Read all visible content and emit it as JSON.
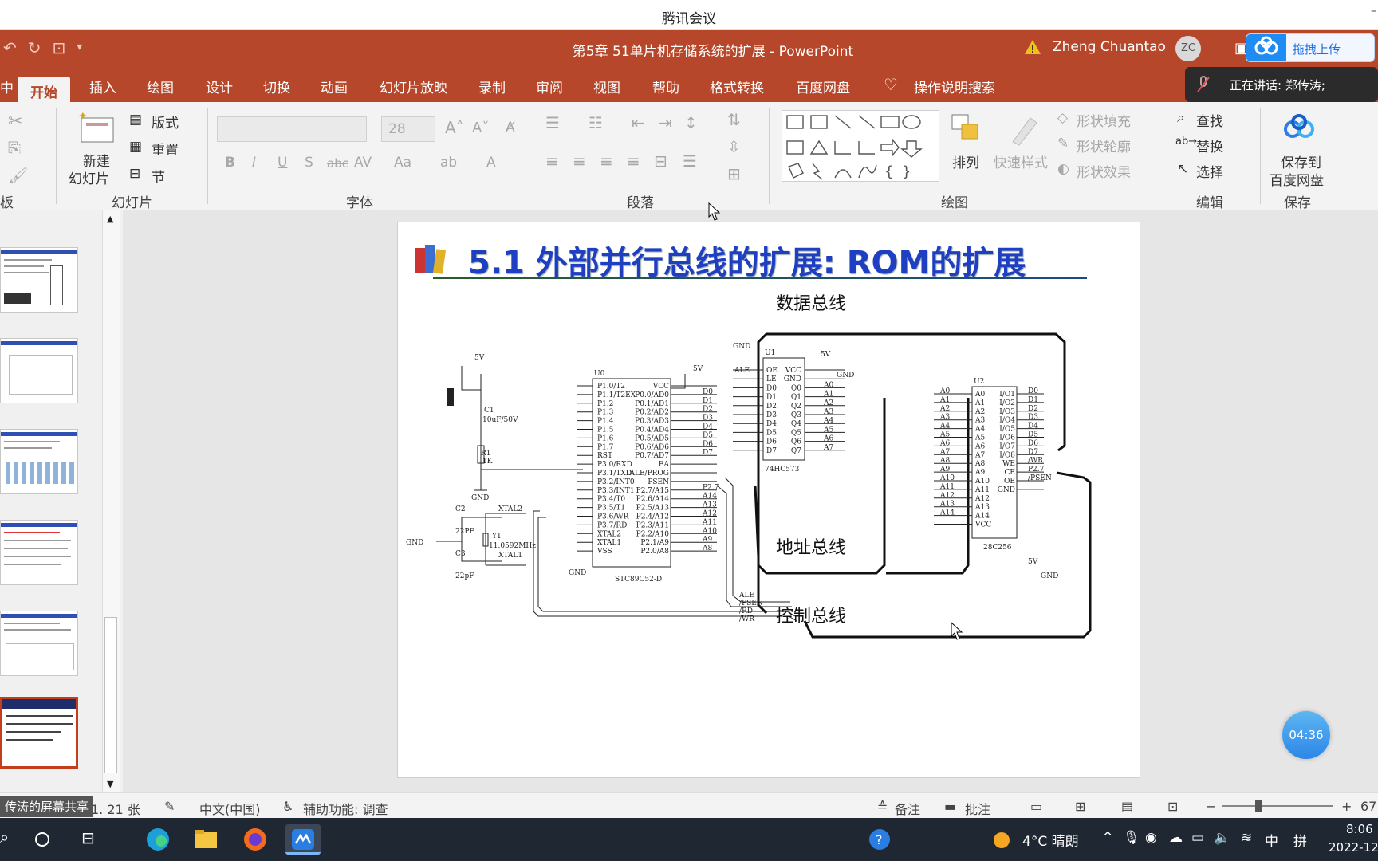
{
  "meeting": {
    "window_title": "腾讯会议",
    "dash": "–"
  },
  "app": {
    "doc_title": "第5章 51单片机存储系统的扩展 - PowerPoint",
    "user_name": "Zheng Chuantao",
    "user_initials": "ZC",
    "upload_label": "拖拽上传",
    "speaking_label": "正在讲话: 郑传涛;"
  },
  "tabs": [
    "中",
    "开始",
    "插入",
    "绘图",
    "设计",
    "切换",
    "动画",
    "幻灯片放映",
    "录制",
    "审阅",
    "视图",
    "帮助",
    "格式转换",
    "百度网盘",
    "操作说明搜索"
  ],
  "ribbon": {
    "clipboard_label": "板",
    "new_slide_line1": "新建",
    "new_slide_line2": "幻灯片",
    "layout": "版式",
    "reset": "重置",
    "section": "节",
    "slides_label": "幻灯片",
    "font_size": "28",
    "font_label": "字体",
    "paragraph_label": "段落",
    "arrange": "排列",
    "quick_styles": "快速样式",
    "shape_fill": "形状填充",
    "shape_outline": "形状轮廓",
    "shape_effects": "形状效果",
    "drawing_label": "绘图",
    "find": "查找",
    "replace": "替换",
    "select": "选择",
    "editing_label": "编辑",
    "save_line1": "保存到",
    "save_line2": "百度网盘",
    "save_label": "保存"
  },
  "slide": {
    "title": "5.1 外部并行总线的扩展: ROM的扩展",
    "bus_data": "数据总线",
    "bus_address": "地址总线",
    "bus_control": "控制总线",
    "chip_mcu": "STC89C52-D",
    "chip_latch": "74HC573",
    "chip_rom": "28C256",
    "crystal": "11.0592MHz",
    "label_u0": "U0",
    "label_u1": "U1",
    "label_u2": "U2",
    "c1": "C1",
    "c1_val": "10uF/50V",
    "r1": "R1",
    "r1_val": "1K",
    "c2": "C2",
    "c2_val": "22PF",
    "c3": "C3",
    "c3_val": "22pF",
    "y1": "Y1",
    "xtal1": "XTAL1",
    "xtal2": "XTAL2",
    "v5": "5V",
    "gnd": "GND",
    "mcu_left_pins": [
      "P1.0/T2",
      "P1.1/T2EX",
      "P1.2",
      "P1.3",
      "P1.4",
      "P1.5",
      "P1.6",
      "P1.7",
      "RST",
      "P3.0/RXD",
      "P3.1/TXD",
      "P3.2/INT0",
      "P3.3/INT1",
      "P3.4/T0",
      "P3.5/T1",
      "P3.6/WR",
      "P3.7/RD",
      "XTAL2",
      "XTAL1",
      "VSS"
    ],
    "mcu_right_pins": [
      "VCC",
      "P0.0/AD0",
      "P0.1/AD1",
      "P0.2/AD2",
      "P0.3/AD3",
      "P0.4/AD4",
      "P0.5/AD5",
      "P0.6/AD6",
      "P0.7/AD7",
      "EA",
      "ALE/PROG",
      "PSEN",
      "P2.7/A15",
      "P2.6/A14",
      "P2.5/A13",
      "P2.4/A12",
      "P2.3/A11",
      "P2.2/A10",
      "P2.1/A9",
      "P2.0/A8"
    ],
    "mcu_right_nets": [
      "",
      "D0",
      "D1",
      "D2",
      "D3",
      "D4",
      "D5",
      "D6",
      "D7",
      "",
      "",
      "",
      "P2.7",
      "A14",
      "A13",
      "A12",
      "A11",
      "A10",
      "A9",
      "A8"
    ],
    "latch_left_pins": [
      "OE",
      "LE",
      "D0",
      "D1",
      "D2",
      "D3",
      "D4",
      "D5",
      "D6",
      "D7"
    ],
    "latch_right_pins": [
      "VCC",
      "GND",
      "Q0",
      "Q1",
      "Q2",
      "Q3",
      "Q4",
      "Q5",
      "Q6",
      "Q7"
    ],
    "latch_right_nets": [
      "",
      "",
      "A0",
      "A1",
      "A2",
      "A3",
      "A4",
      "A5",
      "A6",
      "A7"
    ],
    "rom_left_pins": [
      "A0",
      "A1",
      "A2",
      "A3",
      "A4",
      "A5",
      "A6",
      "A7",
      "A8",
      "A9",
      "A10",
      "A11",
      "A12",
      "A13",
      "A14",
      "VCC"
    ],
    "rom_right_pins": [
      "I/O1",
      "I/O2",
      "I/O3",
      "I/O4",
      "I/O5",
      "I/O6",
      "I/O7",
      "I/O8",
      "WE",
      "CE",
      "OE",
      "GND"
    ],
    "rom_right_nets": [
      "D0",
      "D1",
      "D2",
      "D3",
      "D4",
      "D5",
      "D6",
      "D7",
      "/WR",
      "P2.7",
      "/PSEN",
      ""
    ],
    "ctrl_nets": [
      "ALE",
      "/PSEN",
      "/RD",
      "/WR"
    ],
    "ale_net": "ALE"
  },
  "timer": "04:36",
  "status": {
    "slide_count": "1. 21 张",
    "language": "中文(中国)",
    "accessibility": "辅助功能: 调查",
    "notes": "备注",
    "comments": "批注",
    "zoom": "67",
    "share_badge": "传涛的屏幕共享"
  },
  "taskbar": {
    "weather": "4°C  晴朗",
    "ime": "中",
    "ime2": "拼",
    "time": "8:06",
    "date": "2022-12"
  },
  "colors": {
    "accent": "#b7472a",
    "title_blue": "#1f3fc2",
    "selected_border": "#c43e1c"
  }
}
